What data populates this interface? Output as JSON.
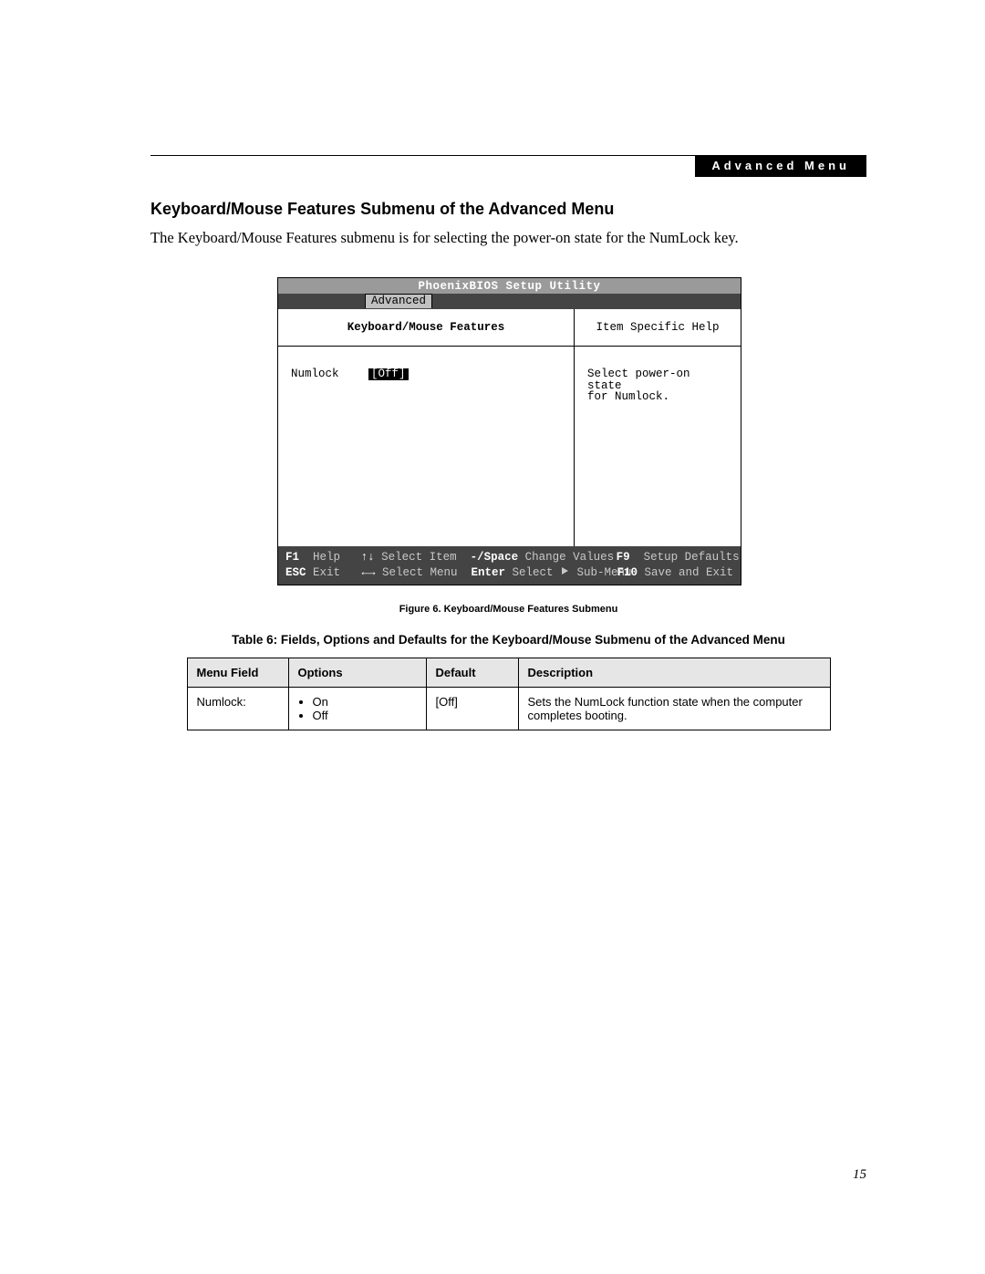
{
  "header_badge": "Advanced Menu",
  "section_title": "Keyboard/Mouse Features Submenu of the Advanced Menu",
  "intro": "The Keyboard/Mouse Features submenu is for selecting the power-on state for the NumLock key.",
  "bios": {
    "title": "PhoenixBIOS Setup Utility",
    "active_tab": "Advanced",
    "left_heading": "Keyboard/Mouse Features",
    "right_heading": "Item Specific Help",
    "field_label": "Numlock",
    "field_value": "[Off]",
    "help_line1": "Select power-on state",
    "help_line2": "for Numlock.",
    "footer": {
      "f1": "F1",
      "help": "Help",
      "arrows_ud": "↑↓",
      "select_item": "Select Item",
      "minus_space": "-/Space",
      "change_values": "Change Values",
      "f9": "F9",
      "setup_defaults": "Setup Defaults",
      "esc": "ESC",
      "exit": "Exit",
      "arrows_lr": "←→",
      "select_menu": "Select Menu",
      "enter": "Enter",
      "select_sub": "Select",
      "sub_menu": "Sub-Menu",
      "f10": "F10",
      "save_exit": "Save and Exit"
    }
  },
  "figure_caption": "Figure 6.  Keyboard/Mouse Features Submenu",
  "table_caption": "Table 6: Fields, Options and Defaults for the Keyboard/Mouse Submenu of the Advanced Menu",
  "table": {
    "headers": {
      "menu": "Menu Field",
      "options": "Options",
      "default": "Default",
      "desc": "Description"
    },
    "rows": [
      {
        "menu": "Numlock:",
        "options": [
          "On",
          "Off"
        ],
        "default": "[Off]",
        "desc": "Sets the NumLock function state when the computer completes booting."
      }
    ]
  },
  "page_number": "15"
}
